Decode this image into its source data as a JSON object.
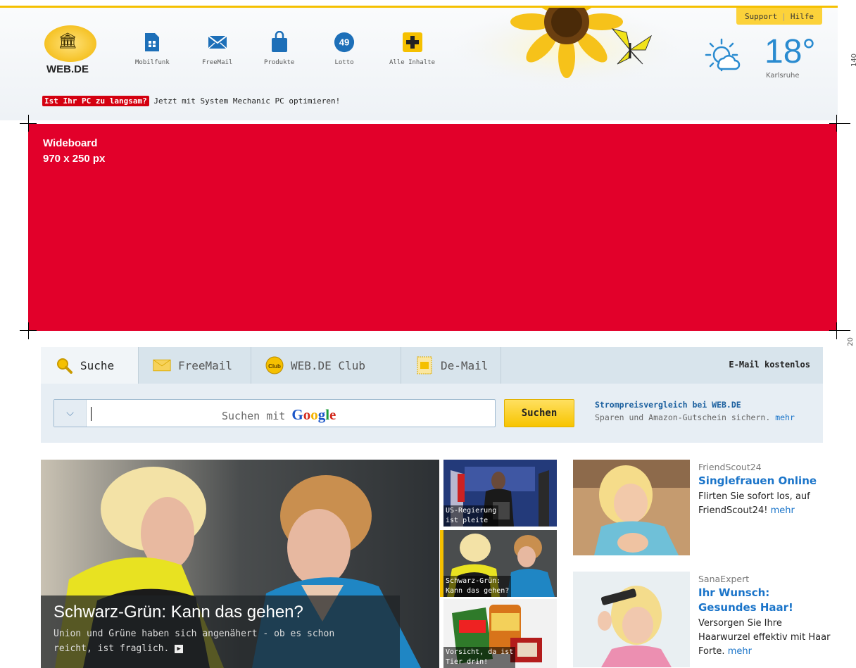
{
  "header": {
    "support_label": "Support",
    "help_label": "Hilfe",
    "logo_text": "WEB.DE",
    "nav": [
      {
        "label": "Mobilfunk",
        "icon": "sim-card-icon"
      },
      {
        "label": "FreeMail",
        "icon": "envelope-icon"
      },
      {
        "label": "Produkte",
        "icon": "shopping-bag-icon"
      },
      {
        "label": "Lotto",
        "icon": "lotto-ball-icon",
        "badge": "49"
      },
      {
        "label": "Alle Inhalte",
        "icon": "plus-icon"
      }
    ],
    "weather": {
      "temperature": "18°",
      "city": "Karlsruhe",
      "icon": "partly-cloudy-icon"
    },
    "side_marker_140": "140",
    "promo_tag": "Ist Ihr PC zu langsam?",
    "promo_text": "Jetzt mit System Mechanic PC optimieren!"
  },
  "wideboard": {
    "title": "Wideboard",
    "size": "970 x 250 px",
    "side_marker": "20",
    "color": "#e2002a"
  },
  "search": {
    "tabs": [
      {
        "label": "Suche",
        "icon": "magnifier-icon",
        "active": true
      },
      {
        "label": "FreeMail",
        "icon": "envelope-icon",
        "active": false
      },
      {
        "label": "WEB.DE Club",
        "icon": "club-icon",
        "active": false
      },
      {
        "label": "De-Mail",
        "icon": "de-mail-icon",
        "active": false
      }
    ],
    "email_free": "E-Mail kostenlos",
    "placeholder_prefix": "Suchen mit",
    "google": "Google",
    "button": "Suchen",
    "ad_title": "Strompreisvergleich bei WEB.DE",
    "ad_text": "Sparen und Amazon-Gutschein sichern.",
    "ad_more": "mehr"
  },
  "hero": {
    "headline": "Schwarz-Grün: Kann das gehen?",
    "description": "Union und Grüne haben sich angenähert - ob es schon reicht, ist fraglich."
  },
  "thumbs": [
    {
      "caption_1": "US-Regierung",
      "caption_2": "ist pleite"
    },
    {
      "caption_1": "Schwarz-Grün:",
      "caption_2": "Kann das gehen?"
    },
    {
      "caption_1": "Vorsicht, da ist",
      "caption_2": "Tier drin!"
    }
  ],
  "ads": [
    {
      "source": "FriendScout24",
      "headline": "Singlefrauen Online",
      "body": "Flirten Sie sofort los, auf FriendScout24!",
      "more": "mehr"
    },
    {
      "source": "SanaExpert",
      "headline_1": "Ihr Wunsch:",
      "headline_2": "Gesundes Haar!",
      "body": "Versorgen Sie Ihre Haarwurzel effektiv mit Haar Forte.",
      "more": "mehr"
    }
  ]
}
